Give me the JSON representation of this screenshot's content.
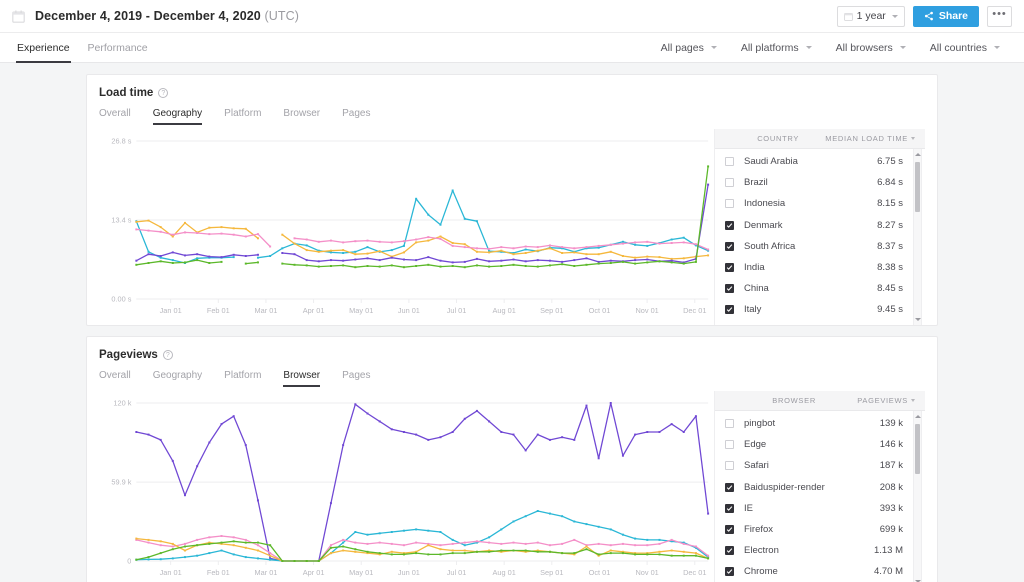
{
  "header": {
    "calendar_icon": "calendar-icon",
    "date_range": "December 4, 2019 - December 4, 2020",
    "timezone": "(UTC)",
    "range_button": "1 year",
    "share_button": "Share",
    "more_button": "•••"
  },
  "nav": {
    "tabs": [
      {
        "label": "Experience",
        "active": true
      },
      {
        "label": "Performance",
        "active": false
      }
    ],
    "filters": [
      {
        "label": "All pages"
      },
      {
        "label": "All platforms"
      },
      {
        "label": "All browsers"
      },
      {
        "label": "All countries"
      }
    ]
  },
  "cards": [
    {
      "title": "Load time",
      "tabs": [
        {
          "label": "Overall",
          "active": false
        },
        {
          "label": "Geography",
          "active": true
        },
        {
          "label": "Platform",
          "active": false
        },
        {
          "label": "Browser",
          "active": false
        },
        {
          "label": "Pages",
          "active": false
        }
      ],
      "table": {
        "col_name": "COUNTRY",
        "col_value": "MEDIAN LOAD TIME",
        "rows": [
          {
            "checked": true,
            "name": "Italy",
            "value": "9.45 s"
          },
          {
            "checked": true,
            "name": "China",
            "value": "8.45 s"
          },
          {
            "checked": true,
            "name": "India",
            "value": "8.38 s"
          },
          {
            "checked": true,
            "name": "South Africa",
            "value": "8.37 s"
          },
          {
            "checked": true,
            "name": "Denmark",
            "value": "8.27 s"
          },
          {
            "checked": false,
            "name": "Indonesia",
            "value": "8.15 s"
          },
          {
            "checked": false,
            "name": "Brazil",
            "value": "6.84 s"
          },
          {
            "checked": false,
            "name": "Saudi Arabia",
            "value": "6.75 s"
          }
        ]
      }
    },
    {
      "title": "Pageviews",
      "tabs": [
        {
          "label": "Overall",
          "active": false
        },
        {
          "label": "Geography",
          "active": false
        },
        {
          "label": "Platform",
          "active": false
        },
        {
          "label": "Browser",
          "active": true
        },
        {
          "label": "Pages",
          "active": false
        }
      ],
      "table": {
        "col_name": "BROWSER",
        "col_value": "PAGEVIEWS",
        "rows": [
          {
            "checked": true,
            "name": "Chrome",
            "value": "4.70 M"
          },
          {
            "checked": true,
            "name": "Electron",
            "value": "1.13 M"
          },
          {
            "checked": true,
            "name": "Firefox",
            "value": "699 k"
          },
          {
            "checked": true,
            "name": "IE",
            "value": "393 k"
          },
          {
            "checked": true,
            "name": "Baiduspider-render",
            "value": "208 k"
          },
          {
            "checked": false,
            "name": "Safari",
            "value": "187 k"
          },
          {
            "checked": false,
            "name": "Edge",
            "value": "146 k"
          },
          {
            "checked": false,
            "name": "pingbot",
            "value": "139 k"
          }
        ]
      }
    }
  ],
  "palette": {
    "cyan": "#2ab7d6",
    "orange": "#f5b83d",
    "pink": "#f48fc8",
    "purple": "#7048d4",
    "green": "#5cb82a",
    "accent_blue": "#2f9fe0",
    "grid": "#ededef",
    "axis_text": "#b9b9bf"
  },
  "chart_data": [
    {
      "type": "line",
      "title": "Load time",
      "xlabel": "",
      "ylabel": "Median load time (s)",
      "ylim": [
        0,
        26.8
      ],
      "y_ticks": [
        "0.00 s",
        "13.4 s",
        "26.8 s"
      ],
      "y_tick_values": [
        0,
        13.4,
        26.8
      ],
      "grid": true,
      "legend": "table",
      "x_ticks": [
        "Jan 01",
        "Feb 01",
        "Mar 01",
        "Apr 01",
        "May 01",
        "Jun 01",
        "Jul 01",
        "Aug 01",
        "Sep 01",
        "Oct 01",
        "Nov 01",
        "Dec 01"
      ],
      "series": [
        {
          "name": "Italy",
          "color": "#2ab7d6",
          "values": [
            13.2,
            8.0,
            7.0,
            6.6,
            6.1,
            6.9,
            7.0,
            7.0,
            7.1,
            null,
            7.0,
            7.3,
            8.6,
            9.4,
            9.1,
            8.2,
            7.9,
            7.8,
            8.0,
            8.8,
            8.0,
            8.3,
            9.0,
            17.0,
            14.3,
            12.6,
            18.4,
            13.6,
            13.2,
            8.1,
            8.0,
            7.8,
            8.4,
            8.1,
            8.7,
            8.6,
            8.0,
            8.6,
            8.7,
            9.2,
            9.7,
            9.2,
            9.0,
            9.5,
            10.1,
            10.4,
            9.1,
            8.2
          ]
        },
        {
          "name": "China",
          "color": "#f5b83d",
          "values": [
            13.1,
            13.3,
            12.2,
            10.6,
            12.9,
            11.3,
            12.1,
            12.2,
            12.0,
            11.9,
            10.3,
            null,
            10.9,
            9.4,
            8.3,
            8.0,
            8.2,
            8.3,
            7.6,
            7.7,
            8.1,
            7.2,
            7.9,
            9.6,
            9.9,
            10.6,
            9.5,
            9.3,
            8.0,
            7.9,
            8.2,
            7.6,
            7.8,
            8.2,
            8.6,
            7.8,
            7.9,
            7.6,
            7.6,
            8.0,
            7.3,
            7.0,
            7.2,
            7.1,
            6.8,
            6.9,
            7.2,
            7.4
          ]
        },
        {
          "name": "India",
          "color": "#f48fc8",
          "values": [
            11.8,
            11.6,
            11.4,
            10.9,
            11.3,
            11.2,
            11.0,
            11.1,
            10.9,
            10.6,
            11.0,
            8.9,
            null,
            10.3,
            10.1,
            9.7,
            9.9,
            9.6,
            9.8,
            9.9,
            9.7,
            9.6,
            9.8,
            10.1,
            10.5,
            10.2,
            9.0,
            8.8,
            8.6,
            8.5,
            8.8,
            8.6,
            8.9,
            8.8,
            9.1,
            8.8,
            8.6,
            8.8,
            9.0,
            9.2,
            9.4,
            9.6,
            9.7,
            9.4,
            9.5,
            9.6,
            9.3,
            8.4
          ]
        },
        {
          "name": "South Africa",
          "color": "#7048d4",
          "values": [
            6.5,
            7.6,
            7.3,
            7.9,
            7.4,
            7.6,
            7.2,
            7.1,
            7.5,
            7.3,
            7.5,
            null,
            7.8,
            7.6,
            6.6,
            6.4,
            6.6,
            6.5,
            6.7,
            6.9,
            6.6,
            7.0,
            6.7,
            6.6,
            7.1,
            6.5,
            6.2,
            6.3,
            6.8,
            6.4,
            6.5,
            6.7,
            6.4,
            6.6,
            6.5,
            6.3,
            6.6,
            6.9,
            6.3,
            6.5,
            6.4,
            6.6,
            6.7,
            6.4,
            6.5,
            6.2,
            6.8,
            19.4
          ]
        },
        {
          "name": "Denmark",
          "color": "#5cb82a",
          "values": [
            5.8,
            6.1,
            6.4,
            6.1,
            6.2,
            6.6,
            6.1,
            6.3,
            null,
            6.0,
            6.2,
            null,
            6.0,
            5.8,
            5.7,
            5.5,
            5.6,
            5.7,
            5.4,
            5.6,
            5.5,
            5.7,
            5.4,
            5.6,
            5.8,
            5.5,
            5.6,
            5.4,
            5.7,
            5.5,
            5.6,
            5.8,
            5.6,
            5.5,
            5.7,
            5.9,
            5.6,
            5.8,
            6.0,
            6.1,
            6.3,
            6.0,
            6.2,
            6.4,
            6.2,
            6.0,
            6.3,
            22.5
          ]
        }
      ]
    },
    {
      "type": "line",
      "title": "Pageviews",
      "xlabel": "",
      "ylabel": "Pageviews",
      "ylim": [
        0,
        120000
      ],
      "y_ticks": [
        "0",
        "59.9 k",
        "120 k"
      ],
      "y_tick_values": [
        0,
        59900,
        120000
      ],
      "grid": true,
      "legend": "table",
      "x_ticks": [
        "Jan 01",
        "Feb 01",
        "Mar 01",
        "Apr 01",
        "May 01",
        "Jun 01",
        "Jul 01",
        "Aug 01",
        "Sep 01",
        "Oct 01",
        "Nov 01",
        "Dec 01"
      ],
      "series": [
        {
          "name": "Chrome",
          "color": "#7048d4",
          "values": [
            98000,
            96000,
            92000,
            76000,
            50000,
            72000,
            90000,
            104000,
            110000,
            88000,
            46000,
            2000,
            0,
            0,
            0,
            0,
            44000,
            88000,
            119000,
            112000,
            106000,
            100000,
            98000,
            96000,
            92000,
            94000,
            98000,
            108000,
            114000,
            106000,
            98000,
            96000,
            84000,
            96000,
            92000,
            94000,
            92000,
            118000,
            78000,
            120000,
            80000,
            96000,
            98000,
            98000,
            104000,
            98000,
            110000,
            36000
          ]
        },
        {
          "name": "Electron",
          "color": "#2ab7d6",
          "values": [
            1000,
            1200,
            1400,
            2000,
            3000,
            4000,
            6000,
            8000,
            5000,
            3000,
            2000,
            1000,
            0,
            0,
            0,
            0,
            6000,
            14000,
            22000,
            20000,
            21000,
            22000,
            23000,
            24000,
            23000,
            22000,
            16000,
            12000,
            14000,
            18000,
            24000,
            30000,
            34000,
            38000,
            36000,
            34000,
            30000,
            28000,
            26000,
            24000,
            20000,
            17000,
            16000,
            16000,
            15000,
            14000,
            10000,
            3000
          ]
        },
        {
          "name": "Firefox",
          "color": "#f48fc8",
          "values": [
            16000,
            14000,
            12000,
            11000,
            13000,
            16000,
            18000,
            19000,
            18000,
            16000,
            12000,
            6000,
            0,
            0,
            0,
            0,
            12000,
            16000,
            14000,
            13000,
            14000,
            13000,
            12000,
            14000,
            13000,
            12000,
            13000,
            14000,
            15000,
            14000,
            13000,
            14000,
            13000,
            14000,
            12000,
            13000,
            16000,
            12000,
            13000,
            12000,
            13000,
            12000,
            12000,
            13000,
            16000,
            13000,
            11000,
            4000
          ]
        },
        {
          "name": "IE",
          "color": "#f5b83d",
          "values": [
            17000,
            16000,
            15000,
            13000,
            8000,
            12000,
            14000,
            13000,
            12000,
            10000,
            8000,
            4000,
            0,
            0,
            0,
            0,
            6000,
            8000,
            7000,
            6000,
            5000,
            7000,
            6000,
            7000,
            12000,
            9000,
            8000,
            8000,
            7000,
            8000,
            7000,
            8000,
            7000,
            8000,
            7000,
            6000,
            5000,
            11000,
            4000,
            8000,
            7000,
            6000,
            6000,
            7000,
            8000,
            7000,
            6000,
            2000
          ]
        },
        {
          "name": "Baiduspider-render",
          "color": "#5cb82a",
          "values": [
            1000,
            3000,
            6000,
            9000,
            11000,
            12000,
            13000,
            14000,
            15000,
            14000,
            14000,
            12000,
            0,
            0,
            0,
            0,
            10000,
            11000,
            9000,
            7000,
            6000,
            5000,
            5000,
            6000,
            5000,
            5000,
            6000,
            6000,
            7000,
            7000,
            8000,
            8000,
            8000,
            7000,
            7000,
            6000,
            6000,
            9000,
            5000,
            6000,
            6000,
            5000,
            5000,
            5000,
            4000,
            4000,
            4000,
            2000
          ]
        }
      ]
    }
  ]
}
